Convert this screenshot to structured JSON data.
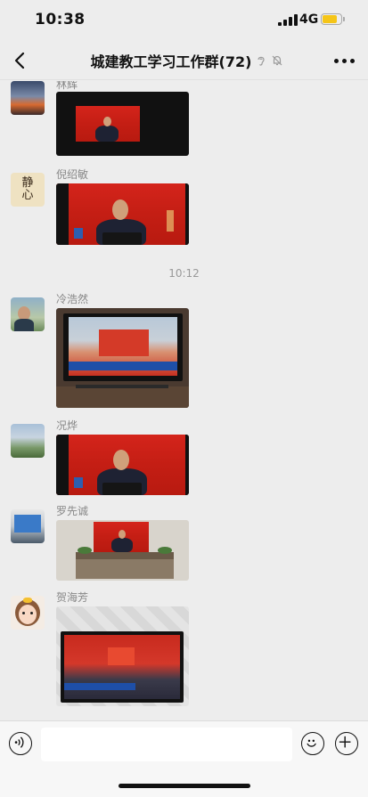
{
  "status_bar": {
    "time": "10:38",
    "network": "4G",
    "battery_level": 0.8
  },
  "nav": {
    "title": "城建教工学习工作群(72)"
  },
  "messages": [
    {
      "sender": "林辉"
    },
    {
      "sender": "倪绍敏",
      "avatar_text": "静心"
    },
    {
      "timestamp": "10:12"
    },
    {
      "sender": "冷浩然"
    },
    {
      "sender": "况烨"
    },
    {
      "sender": "罗先诚"
    },
    {
      "sender": "贺海芳"
    }
  ],
  "colors": {
    "background": "#ededed",
    "screen_red": "#c41e14",
    "battery": "#f5c518"
  }
}
